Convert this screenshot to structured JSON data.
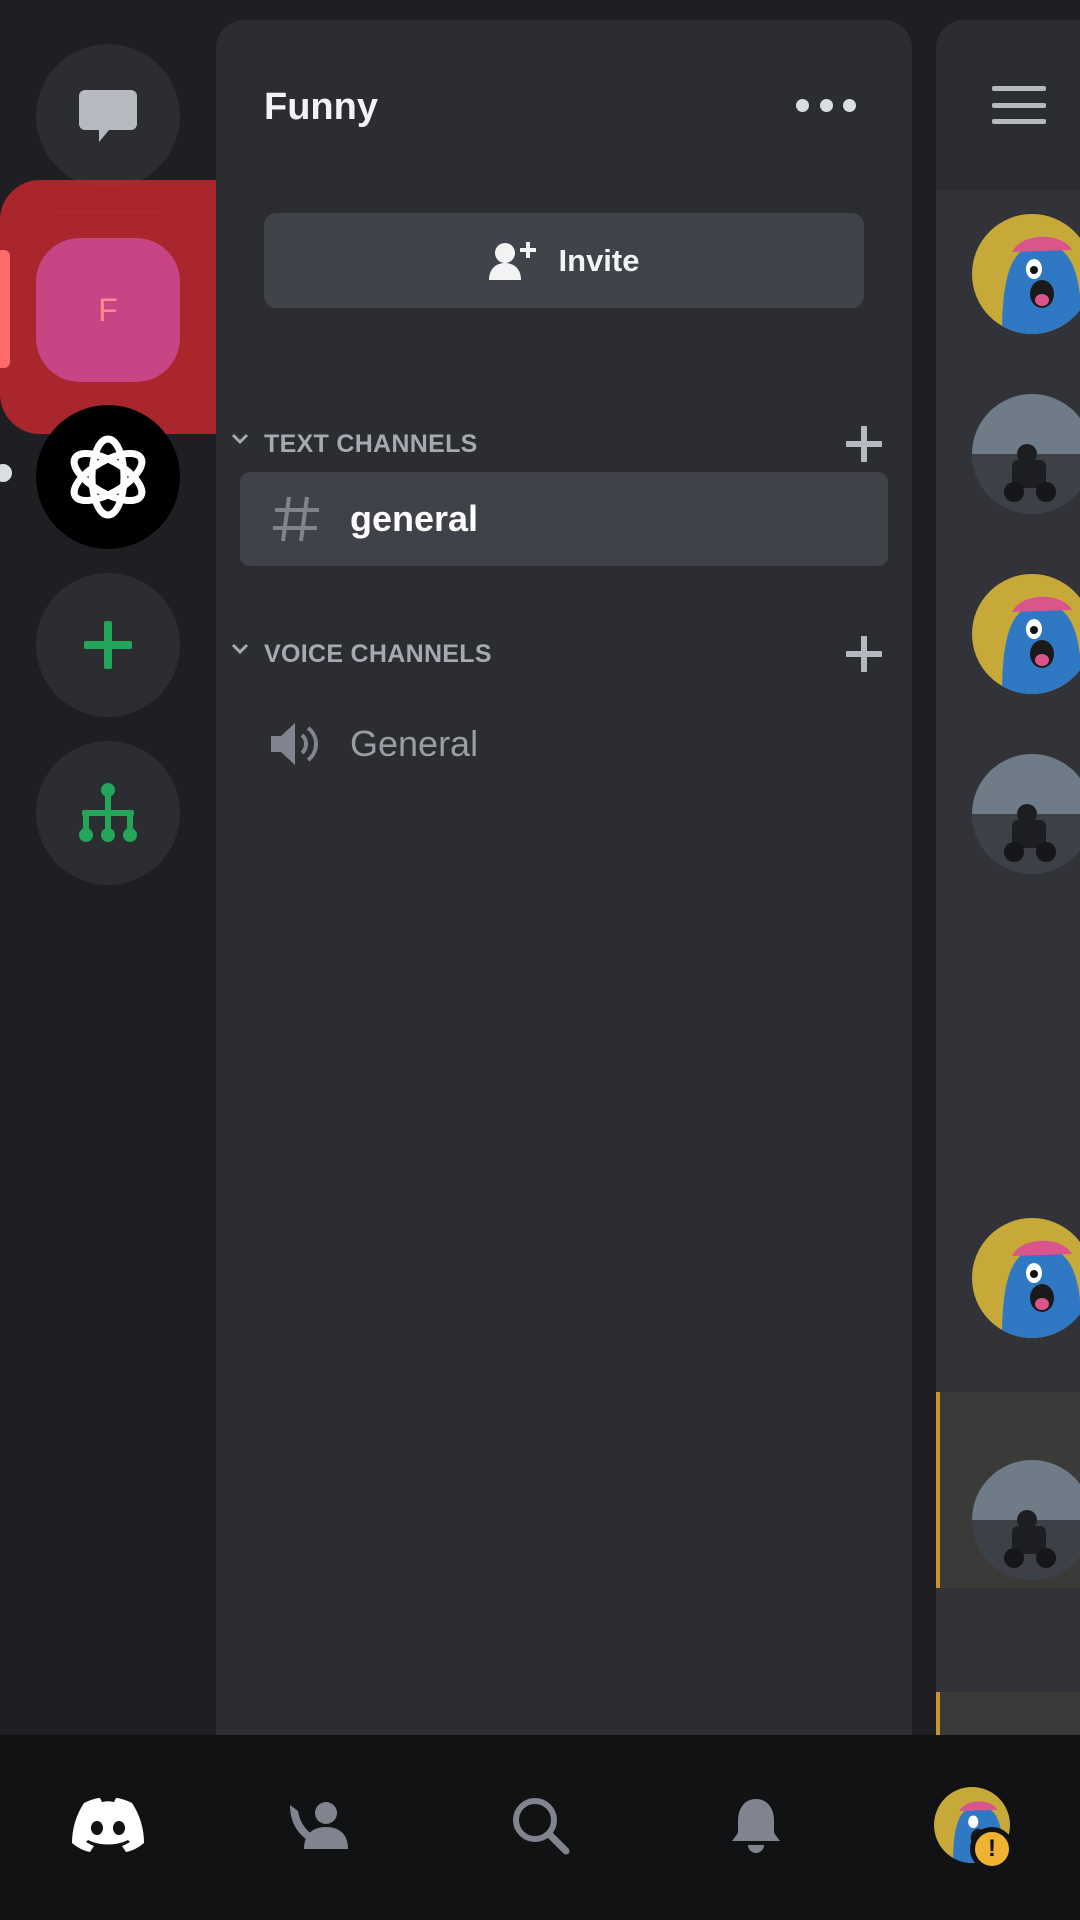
{
  "server": {
    "name": "Funny",
    "initial": "F"
  },
  "header": {
    "invite_label": "Invite"
  },
  "categories": {
    "text": "TEXT CHANNELS",
    "voice": "VOICE CHANNELS"
  },
  "channels": {
    "text": [
      {
        "name": "general",
        "selected": true
      }
    ],
    "voice": [
      {
        "name": "General"
      }
    ]
  },
  "bottom_nav": {
    "items": [
      "home-icon",
      "friends-icon",
      "search-icon",
      "notifications-icon",
      "profile-avatar"
    ],
    "active": "home-icon",
    "profile_badge": "!"
  },
  "colors": {
    "accent_green": "#23a55a",
    "highlight_red": "#b5282e",
    "server_pink": "#c74585",
    "warning": "#f0b232"
  }
}
